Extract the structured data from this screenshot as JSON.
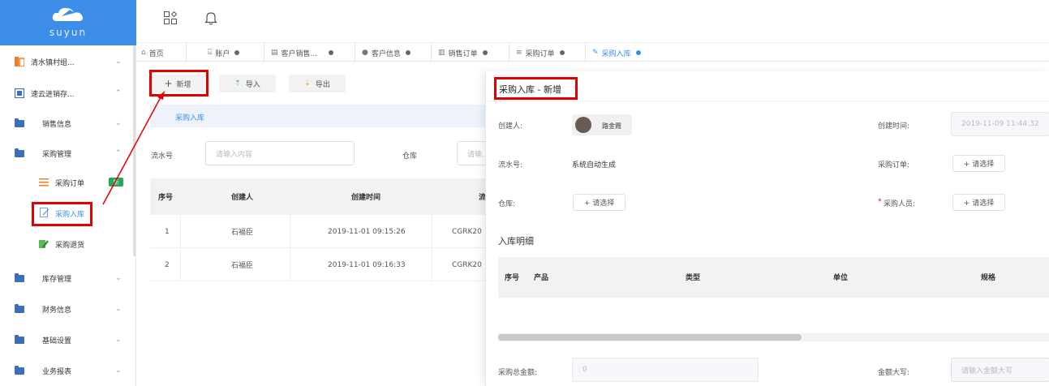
{
  "brand": {
    "name": "suyun"
  },
  "sidebar": {
    "items": [
      {
        "label": "清水镇村组...",
        "chevron": "⌄",
        "icon": "org-icon"
      },
      {
        "label": "速云进销存...",
        "chevron": "⌃",
        "icon": "app-icon"
      },
      {
        "label": "销售信息",
        "chevron": "⌄",
        "icon": "folder-icon"
      },
      {
        "label": "采购管理",
        "chevron": "⌃",
        "icon": "folder-icon"
      },
      {
        "label": "库存管理",
        "chevron": "⌄",
        "icon": "folder-icon"
      },
      {
        "label": "财务信息",
        "chevron": "⌄",
        "icon": "folder-icon"
      },
      {
        "label": "基础设置",
        "chevron": "⌄",
        "icon": "folder-icon"
      },
      {
        "label": "业务报表",
        "chevron": "⌄",
        "icon": "folder-icon"
      }
    ],
    "subitems": [
      {
        "label": "采购订单",
        "badge": "新",
        "icon": "list-icon"
      },
      {
        "label": "采购入库",
        "icon": "edit-icon"
      },
      {
        "label": "采购退货",
        "icon": "return-icon"
      }
    ]
  },
  "tabs": [
    {
      "label": "首页",
      "icon": "home-icon"
    },
    {
      "label": "账户",
      "icon": "account-icon"
    },
    {
      "label": "客户销售...",
      "icon": "doc-icon"
    },
    {
      "label": "客户信息",
      "icon": "user-icon"
    },
    {
      "label": "销售订单",
      "icon": "order-icon"
    },
    {
      "label": "采购订单",
      "icon": "list-icon"
    },
    {
      "label": "采购入库",
      "icon": "edit-icon"
    }
  ],
  "toolbar": {
    "add": "新增",
    "import": "导入",
    "export": "导出"
  },
  "list": {
    "section_title": "采购入库",
    "filters": {
      "serial_label": "流水号",
      "serial_placeholder": "请输入内容",
      "warehouse_label": "仓库",
      "warehouse_placeholder": "请输..."
    },
    "columns": [
      "序号",
      "创建人",
      "创建时间",
      "流"
    ],
    "rows": [
      [
        "1",
        "石福臣",
        "2019-11-01 09:15:26",
        "CGRK20"
      ],
      [
        "2",
        "石福臣",
        "2019-11-01 09:16:33",
        "CGRK20"
      ]
    ]
  },
  "drawer": {
    "title": "采购入库 - 新增",
    "creator_label": "创建人:",
    "creator_name": "路金霞",
    "create_time_label": "创建时间:",
    "create_time_value": "2019-11-09 11:44:32",
    "serial_label": "流水号:",
    "serial_value": "系统自动生成",
    "purchase_order_label": "采购订单:",
    "select_label": "+ 请选择",
    "warehouse_label": "仓库:",
    "buyer_label": "采购人员:",
    "required_mark": "*",
    "detail_title": "入库明细",
    "detail_columns": [
      "序号",
      "产品",
      "类型",
      "单位",
      "规格"
    ],
    "total_label": "采购总金额:",
    "total_value": "0",
    "amount_upper_label": "金额大写:",
    "amount_upper_placeholder": "请输入金额大写"
  },
  "colors": {
    "brand": "#3d8ee8",
    "highlight": "#e00000"
  }
}
